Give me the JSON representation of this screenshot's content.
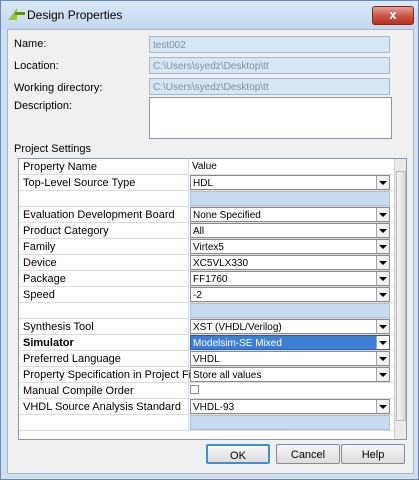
{
  "window": {
    "title": "Design Properties",
    "close_label": "x"
  },
  "fields": {
    "name_label": "Name:",
    "name_value": "test002",
    "location_label": "Location:",
    "location_value": "C:\\Users\\syedz\\Desktop\\tt",
    "workdir_label": "Working directory:",
    "workdir_value": "C:\\Users\\syedz\\Desktop\\tt",
    "description_label": "Description:"
  },
  "project_settings": {
    "section_label": "Project Settings",
    "header": {
      "property": "Property Name",
      "value": "Value"
    },
    "rows": [
      {
        "name": "Top-Level Source Type",
        "value": "HDL",
        "type": "combo"
      },
      {
        "name": "",
        "value": "",
        "type": "blank"
      },
      {
        "name": "Evaluation Development Board",
        "value": "None Specified",
        "type": "combo"
      },
      {
        "name": "Product Category",
        "value": "All",
        "type": "combo"
      },
      {
        "name": "Family",
        "value": "Virtex5",
        "type": "combo"
      },
      {
        "name": "Device",
        "value": "XC5VLX330",
        "type": "combo"
      },
      {
        "name": "Package",
        "value": "FF1760",
        "type": "combo"
      },
      {
        "name": "Speed",
        "value": "-2",
        "type": "combo"
      },
      {
        "name": "",
        "value": "",
        "type": "blank"
      },
      {
        "name": "Synthesis Tool",
        "value": "XST (VHDL/Verilog)",
        "type": "combo"
      },
      {
        "name": "Simulator",
        "value": "Modelsim-SE Mixed",
        "type": "combo",
        "selected": true
      },
      {
        "name": "Preferred Language",
        "value": "VHDL",
        "type": "combo"
      },
      {
        "name": "Property Specification in Project File",
        "value": "Store all values",
        "type": "combo"
      },
      {
        "name": "Manual Compile Order",
        "value": "",
        "type": "checkbox",
        "checked": false
      },
      {
        "name": "VHDL Source Analysis Standard",
        "value": "VHDL-93",
        "type": "combo"
      },
      {
        "name": "",
        "value": "",
        "type": "blank"
      }
    ]
  },
  "buttons": {
    "ok": "OK",
    "cancel": "Cancel",
    "help": "Help"
  },
  "colors": {
    "title_bg": "#cfe0f3",
    "selected_row": "#3c7fd6",
    "close_button": "#c75340"
  }
}
